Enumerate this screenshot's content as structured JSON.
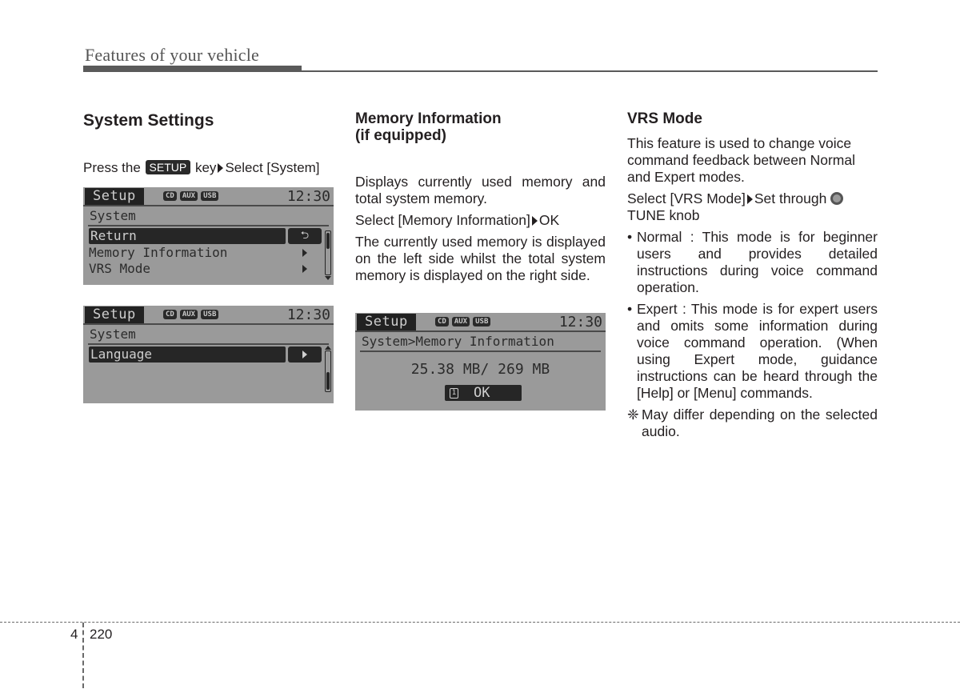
{
  "header": {
    "title": "Features of your vehicle"
  },
  "col1": {
    "heading": "System Settings",
    "instruction": {
      "pre": "Press the",
      "key": "SETUP",
      "mid": "key",
      "post": "Select [System]"
    },
    "screen1": {
      "tab": "Setup",
      "badges": [
        "CD",
        "AUX",
        "USB"
      ],
      "clock": "12:30",
      "crumb": "System",
      "items": [
        {
          "label": "Return",
          "selected": true,
          "action": "return-icon",
          "action_glyph": "⮌"
        },
        {
          "label": "Memory Information",
          "selected": false,
          "action": "arrow-right-icon"
        },
        {
          "label": "VRS Mode",
          "selected": false,
          "action": "arrow-right-icon"
        }
      ]
    },
    "screen2": {
      "tab": "Setup",
      "badges": [
        "CD",
        "AUX",
        "USB"
      ],
      "clock": "12:30",
      "crumb": "System",
      "items": [
        {
          "label": "Language",
          "selected": true,
          "action": "arrow-right-icon"
        }
      ]
    }
  },
  "col2": {
    "heading_line1": "Memory Information",
    "heading_line2": "(if equipped)",
    "para1": "Displays currently used memory and total system memory.",
    "step": {
      "pre": "Select [Memory Information]",
      "post": "OK"
    },
    "para2": "The currently used memory is displayed on the left side whilst the total system memory is displayed on the right side.",
    "screen": {
      "tab": "Setup",
      "badges": [
        "CD",
        "AUX",
        "USB"
      ],
      "clock": "12:30",
      "crumb": "System>Memory Information",
      "memory_value": "25.38 MB/ 269 MB",
      "ok_number": "1",
      "ok_label": "OK"
    }
  },
  "col3": {
    "heading": "VRS Mode",
    "para1": "This feature is used to change voice command feedback between Normal and Expert modes.",
    "step": {
      "pre": "Select [VRS Mode]",
      "mid": "Set through",
      "post": "TUNE knob"
    },
    "bullets": [
      {
        "mark": "•",
        "text": "Normal : This mode is for beginner users and provides detailed instructions during voice command operation."
      },
      {
        "mark": "•",
        "text": "Expert : This mode is for expert users and omits some information during voice command operation. (When using Expert mode, guidance instructions can be heard through the [Help] or [Menu] commands."
      }
    ],
    "note": {
      "mark": "❈",
      "text": "May differ depending on the selected audio."
    }
  },
  "footer": {
    "chapter": "4",
    "page": "220"
  }
}
